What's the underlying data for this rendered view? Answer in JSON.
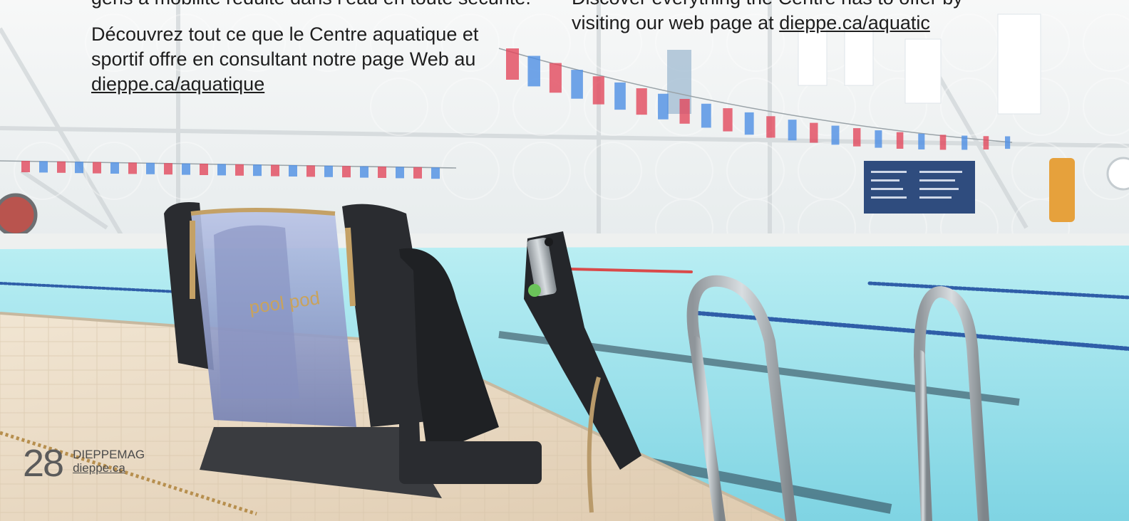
{
  "french": {
    "line1": "gens à mobilité réduite dans l’eau en toute sécurité.",
    "line2_start": "Découvrez tout ce que le Centre aquatique et sportif offre en consultant notre page Web au ",
    "link": "dieppe.ca/aquatique"
  },
  "english": {
    "line1": "Discover everything the Centre has to offer by visiting our web page at ",
    "link": "dieppe.ca/aquatic"
  },
  "photo": {
    "lift_brand": "pool pod"
  },
  "footer": {
    "page_number": "28",
    "magazine": "DIEPPEMAG",
    "site": "dieppe.ca"
  },
  "colors": {
    "water": "#8fd9e6",
    "deck": "#e8d9c4",
    "wall": "#eef2f4",
    "lift": "#2a2c30",
    "flag_red": "#e2485c",
    "flag_blue": "#4d8fe3"
  }
}
